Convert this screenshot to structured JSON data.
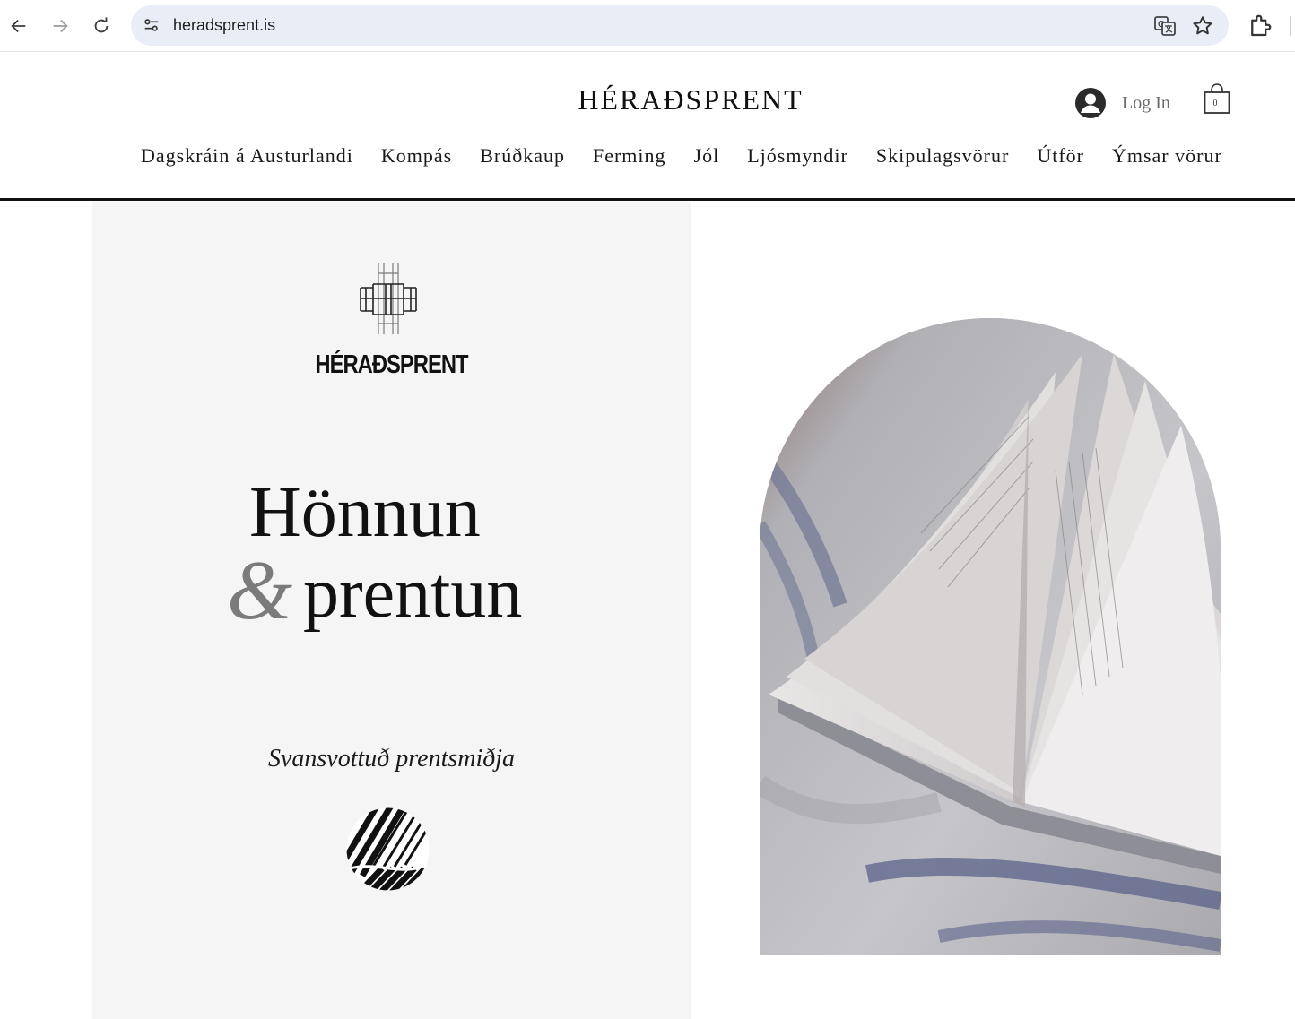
{
  "browser": {
    "url": "heradsprent.is",
    "icons": {
      "back": "back-arrow-icon",
      "forward": "forward-arrow-icon",
      "reload": "reload-icon",
      "site_info": "tune-icon",
      "translate": "translate-icon",
      "bookmark": "star-icon",
      "extensions": "puzzle-icon"
    }
  },
  "header": {
    "site_title": "HÉRAÐSPRENT",
    "login_label": "Log In",
    "cart_count": "0",
    "nav": [
      "Dagskráin á Austurlandi",
      "Kompás",
      "Brúðkaup",
      "Ferming",
      "Jól",
      "Ljósmyndir",
      "Skipulagsvörur",
      "Útför",
      "Ýmsar vörur"
    ]
  },
  "hero": {
    "logo_text": "HÉRAÐSPRENT",
    "headline_line1": "Hönnun",
    "headline_amp": "&",
    "headline_line2": "prentun",
    "subtitle": "Svansvottuð prentsmiðja"
  },
  "colors": {
    "omnibox_bg": "#e9eef6",
    "hero_panel_bg": "#f5f5f5",
    "header_rule": "#111111",
    "amp_gray": "#7b7b7b"
  }
}
